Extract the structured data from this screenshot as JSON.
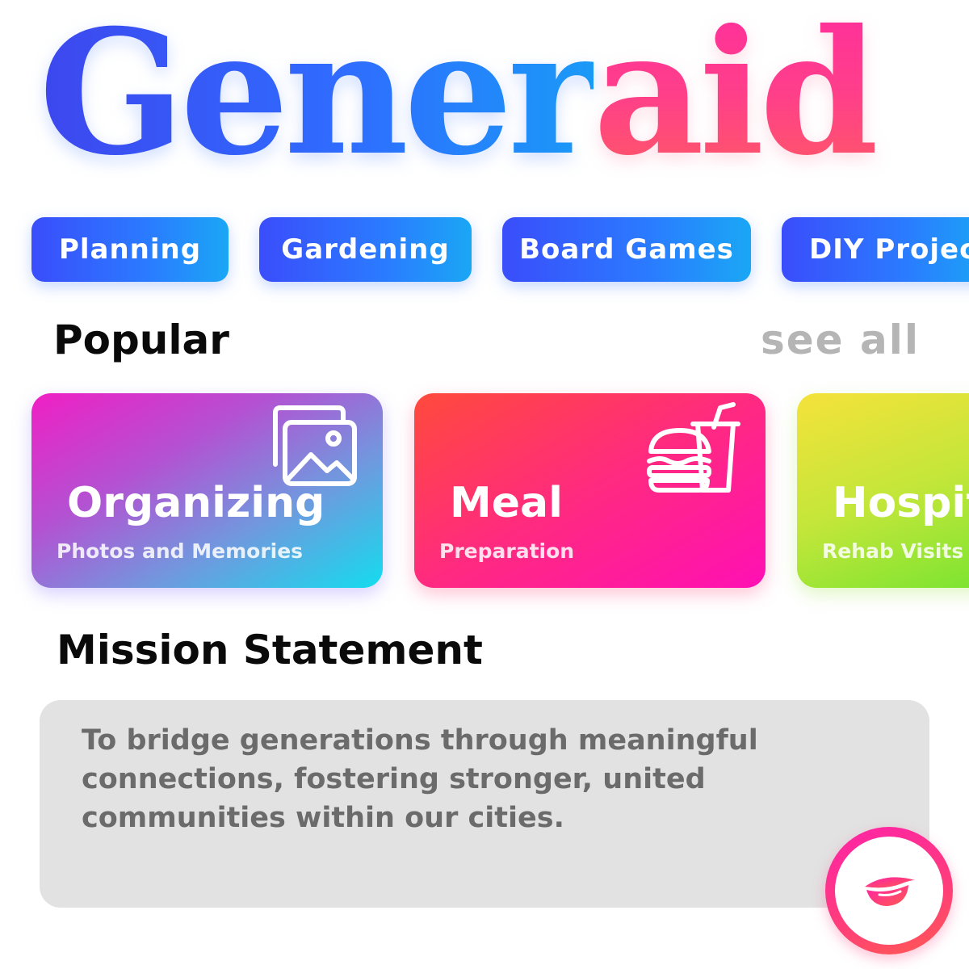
{
  "app": {
    "logo_part1": "Gener",
    "logo_part2": "aid"
  },
  "categories": [
    {
      "label": "Planning"
    },
    {
      "label": "Gardening"
    },
    {
      "label": "Board Games"
    },
    {
      "label": "DIY Projects"
    }
  ],
  "popular": {
    "title": "Popular",
    "see_all_label": "see all",
    "cards": [
      {
        "title": "Organizing",
        "subtitle": "Photos and Memories",
        "icon": "image-gallery-icon"
      },
      {
        "title": "Meal",
        "subtitle": "Preparation",
        "icon": "burger-drink-icon"
      },
      {
        "title": "Hospital",
        "subtitle": "Rehab Visits",
        "icon": ""
      }
    ]
  },
  "mission": {
    "title": "Mission Statement",
    "text": "To bridge generations through meaningful connections, fostering stronger, united communities within our cities."
  },
  "fab": {
    "icon": "leaf-lips-icon"
  },
  "colors": {
    "chip_gradient_start": "#3a4dfb",
    "chip_gradient_end": "#1aa7f5",
    "logo_blue": "#2f6cff",
    "logo_pink": "#ff3f8a",
    "see_all_gray": "#b5b5b5",
    "mission_bg": "#e2e2e2",
    "mission_text": "#6b6b6b"
  }
}
